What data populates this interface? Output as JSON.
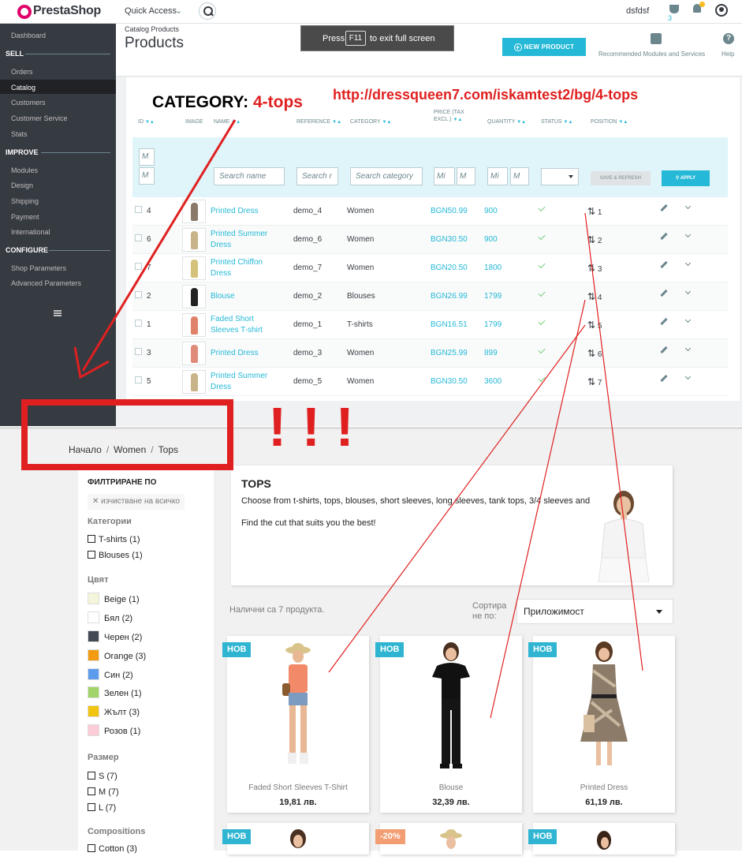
{
  "admin": {
    "logo": "PrestaShop",
    "quick_access": "Quick Access",
    "username": "dsfdsf",
    "trophy_count": "3",
    "breadcrumb": "Catalog  Products",
    "page_title": "Products",
    "fullscreen": {
      "press": "Press",
      "key": "F11",
      "rest": "to exit full screen"
    },
    "new_product": "NEW PRODUCT",
    "recommended": "Recommended Modules and Services",
    "help": "Help",
    "sidebar": {
      "dashboard": "Dashboard",
      "sell": "SELL",
      "orders": "Orders",
      "catalog": "Catalog",
      "customers": "Customers",
      "customer_service": "Customer Service",
      "stats": "Stats",
      "improve": "IMPROVE",
      "modules": "Modules",
      "design": "Design",
      "shipping": "Shipping",
      "payment": "Payment",
      "international": "International",
      "configure": "CONFIGURE",
      "shop_parameters": "Shop Parameters",
      "advanced_parameters": "Advanced Parameters"
    },
    "annotation": {
      "category_label": "CATEGORY:",
      "category_value": "4-tops",
      "url": "http://dressqueen7.com/iskamtest2/bg/4-tops"
    },
    "columns": {
      "id": "ID",
      "image": "IMAGE",
      "name": "NAME",
      "reference": "REFERENCE",
      "category": "CATEGORY",
      "price": "PRICE (TAX EXCL.)",
      "quantity": "QUANTITY",
      "status": "STATUS",
      "position": "POSITION"
    },
    "filters": {
      "id_min": "M",
      "id_max": "M",
      "name": "Search name",
      "reference": "Search r",
      "category": "Search category",
      "price_min": "Mi",
      "price_max": "M",
      "qty_min": "Mi",
      "qty_max": "M",
      "save_refresh": "SAVE & REFRESH",
      "apply": "APPLY"
    },
    "rows": [
      {
        "id": "4",
        "name": "Printed Dress",
        "ref": "demo_4",
        "category": "Women",
        "price": "BGN50.99",
        "qty": "900",
        "position": "1"
      },
      {
        "id": "6",
        "name": "Printed Summer Dress",
        "ref": "demo_6",
        "category": "Women",
        "price": "BGN30.50",
        "qty": "900",
        "position": "2"
      },
      {
        "id": "7",
        "name": "Printed Chiffon Dress",
        "ref": "demo_7",
        "category": "Women",
        "price": "BGN20.50",
        "qty": "1800",
        "position": "3"
      },
      {
        "id": "2",
        "name": "Blouse",
        "ref": "demo_2",
        "category": "Blouses",
        "price": "BGN26.99",
        "qty": "1799",
        "position": "4"
      },
      {
        "id": "1",
        "name": "Faded Short Sleeves T-shirt",
        "ref": "demo_1",
        "category": "T-shirts",
        "price": "BGN16.51",
        "qty": "1799",
        "position": "5"
      },
      {
        "id": "3",
        "name": "Printed Dress",
        "ref": "demo_3",
        "category": "Women",
        "price": "BGN25.99",
        "qty": "899",
        "position": "6"
      },
      {
        "id": "5",
        "name": "Printed Summer Dress",
        "ref": "demo_5",
        "category": "Women",
        "price": "BGN30.50",
        "qty": "3600",
        "position": "7"
      }
    ],
    "exclaim": "! ! !"
  },
  "store": {
    "breadcrumb": [
      "Начало",
      "Women",
      "Tops"
    ],
    "filter_title": "ФИЛТРИРАНЕ ПО",
    "clear_all": "изчистване на всичко",
    "categories_head": "Категории",
    "categories": [
      "T-shirts (1)",
      "Blouses (1)"
    ],
    "color_head": "Цвят",
    "colors": [
      {
        "label": "Beige (1)",
        "hex": "#f5f5dc"
      },
      {
        "label": "Бял (2)",
        "hex": "#ffffff"
      },
      {
        "label": "Черен (2)",
        "hex": "#434a54"
      },
      {
        "label": "Orange (3)",
        "hex": "#f39c11"
      },
      {
        "label": "Син (2)",
        "hex": "#5d9cec"
      },
      {
        "label": "Зелен (1)",
        "hex": "#a0d468"
      },
      {
        "label": "Жълт (3)",
        "hex": "#f1c40f"
      },
      {
        "label": "Розов (1)",
        "hex": "#fcccd8"
      }
    ],
    "size_head": "Размер",
    "sizes": [
      "S (7)",
      "M (7)",
      "L (7)"
    ],
    "compositions_head": "Compositions",
    "compositions": [
      "Cotton (3)"
    ],
    "category_title": "TOPS",
    "category_desc": "Choose from t-shirts, tops, blouses, short sleeves, long sleeves, tank tops, 3/4 sleeves and",
    "category_desc2": "Find the cut that suits you the best!",
    "count": "Налични са 7 продукта.",
    "sort_label_1": "Сортира",
    "sort_label_2": "не по:",
    "sort_value": "Приложимост",
    "products": [
      {
        "badge": "НОВ",
        "name": "Faded Short Sleeves T-Shirt",
        "price": "19,81 лв."
      },
      {
        "badge": "НОВ",
        "name": "Blouse",
        "price": "32,39 лв."
      },
      {
        "badge": "НОВ",
        "name": "Printed Dress",
        "price": "61,19 лв."
      }
    ],
    "products_row2": [
      {
        "badge": "НОВ"
      },
      {
        "badge": "-20%"
      },
      {
        "badge": "НОВ"
      }
    ]
  }
}
